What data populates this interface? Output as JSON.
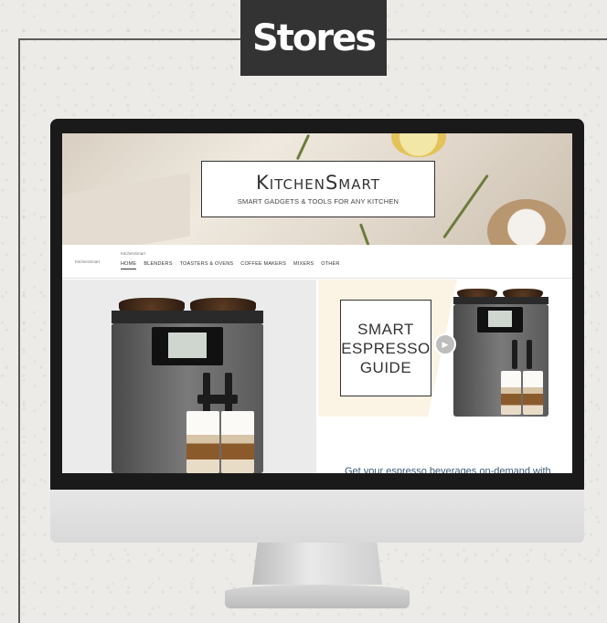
{
  "page": {
    "badge_title": "Stores"
  },
  "store": {
    "logo_title": "KitchenSmart",
    "logo_subtitle": "SMART GADGETS & TOOLS FOR ANY KITCHEN",
    "nav_brand": "KitchenSmart",
    "nav_store_name": "KitchenSmart",
    "nav_items": [
      {
        "label": "HOME",
        "active": true
      },
      {
        "label": "BLENDERS",
        "active": false
      },
      {
        "label": "TOASTERS & OVENS",
        "active": false
      },
      {
        "label": "COFFEE MAKERS",
        "active": false
      },
      {
        "label": "MIXERS",
        "active": false
      },
      {
        "label": "OTHER",
        "active": false
      }
    ],
    "guide_lines": [
      "SMART",
      "ESPRESSO",
      "GUIDE"
    ],
    "tagline": "Get your espresso beverages on-demand with"
  },
  "icons": {
    "play": "play-icon"
  },
  "colors": {
    "badge_bg": "#333333",
    "tagline": "#3b5a7a",
    "guide_bg": "#fbf3e4"
  }
}
